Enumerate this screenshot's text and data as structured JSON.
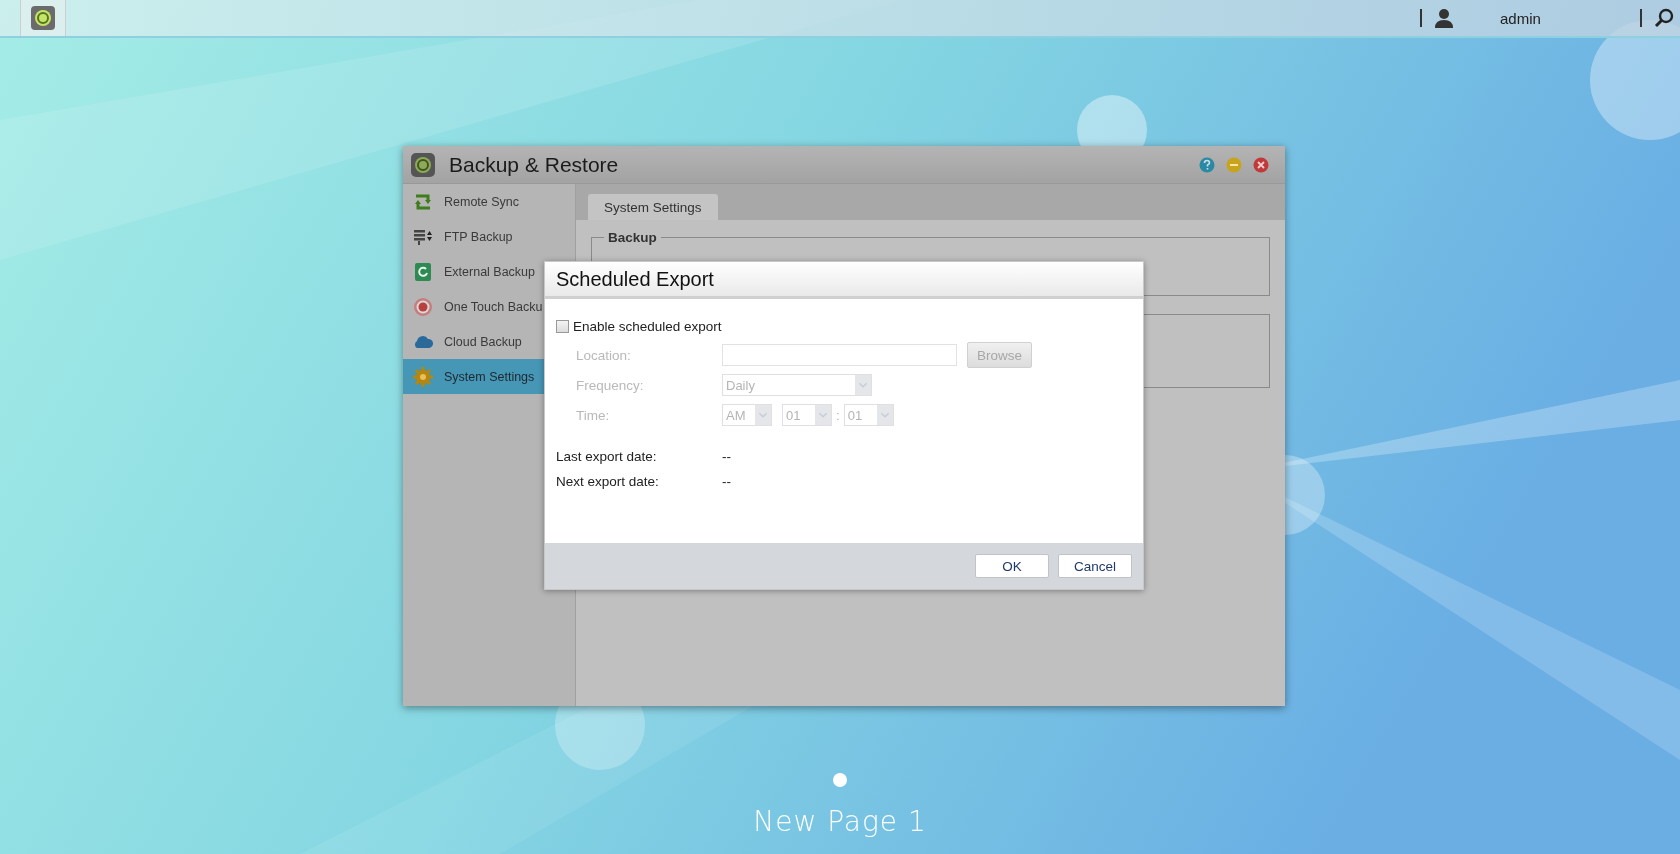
{
  "top_bar": {
    "user": "admin"
  },
  "window": {
    "title": "Backup & Restore",
    "sidebar": {
      "items": [
        {
          "label": "Remote Sync",
          "selected": false
        },
        {
          "label": "FTP Backup",
          "selected": false
        },
        {
          "label": "External Backup",
          "selected": false
        },
        {
          "label": "One Touch Backu",
          "selected": false
        },
        {
          "label": "Cloud Backup",
          "selected": false
        },
        {
          "label": "System Settings",
          "selected": true
        }
      ]
    },
    "tabs": [
      {
        "label": "System Settings",
        "selected": true
      }
    ],
    "sections": [
      {
        "legend": "Backup"
      }
    ]
  },
  "dialog": {
    "title": "Scheduled Export",
    "enable": {
      "label": "Enable scheduled export",
      "checked": false
    },
    "fields": [
      {
        "kind": "text",
        "label": "Location:",
        "disabled": true,
        "button": "Browse"
      },
      {
        "kind": "select",
        "label": "Frequency:",
        "disabled": true,
        "value": "Daily"
      },
      {
        "kind": "time",
        "label": "Time:",
        "disabled": true,
        "parts": [
          "AM",
          "01",
          "01"
        ],
        "separator": ":"
      }
    ],
    "info": [
      {
        "label": "Last export date:",
        "value": "--"
      },
      {
        "label": "Next export date:",
        "value": "--"
      }
    ],
    "buttons": [
      "OK",
      "Cancel"
    ]
  },
  "page_indicator": {
    "label": "New Page 1"
  }
}
